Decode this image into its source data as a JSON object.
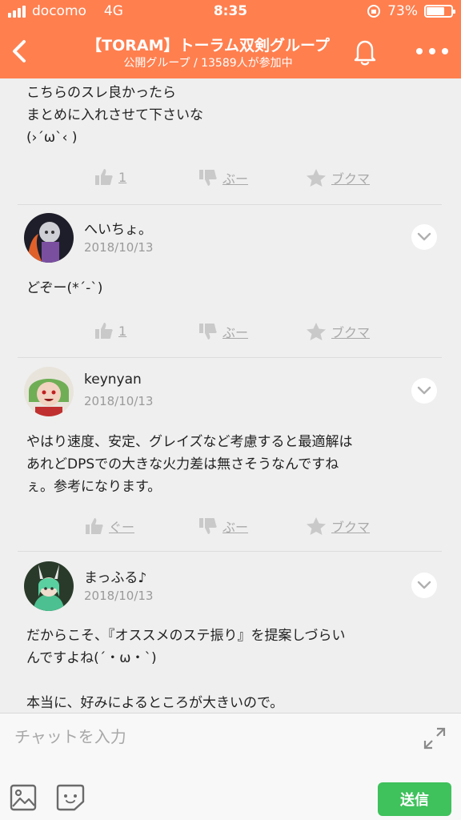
{
  "status_bar": {
    "carrier": "docomo",
    "network": "4G",
    "time": "8:35",
    "battery": "73%",
    "battery_level": 0.73
  },
  "header": {
    "title": "【TORAM】トーラム双剣グループ",
    "subtitle": "公開グループ / 13589人が参加中",
    "back_icon": "chevron-left-icon",
    "bell_icon": "bell-icon",
    "more_icon": "more-dots-icon"
  },
  "posts": [
    {
      "text": "こちらのスレ良かったら\nまとめに入れさせて下さいな\n(›´ω`‹ )",
      "reactions": {
        "like": "1",
        "dislike": "ぶー",
        "bookmark": "ブクマ"
      }
    },
    {
      "username": "へいちょ。",
      "date": "2018/10/13",
      "text": "どぞー(*´-`)",
      "reactions": {
        "like": "1",
        "dislike": "ぶー",
        "bookmark": "ブクマ"
      }
    },
    {
      "username": "keynyan",
      "date": "2018/10/13",
      "text": "やはり速度、安定、グレイズなど考慮すると最適解は\nあれどDPSでの大きな火力差は無さそうなんですね\nぇ。参考になります。",
      "reactions": {
        "like": "ぐー",
        "dislike": "ぶー",
        "bookmark": "ブクマ"
      }
    },
    {
      "username": "まっふる♪",
      "date": "2018/10/13",
      "text": "だからこそ、『オススメのステ振り』を提案しづらい\nんですよね(´・ω・`)\n\n本当に、好みによるところが大きいので。"
    }
  ],
  "composer": {
    "placeholder": "チャットを入力",
    "send_label": "送信",
    "image_icon": "image-icon",
    "sticker_icon": "sticker-icon",
    "expand_icon": "expand-icon"
  },
  "colors": {
    "accent": "#ff7f4f",
    "send": "#3fc15c",
    "reaction": "#a9a9a9"
  }
}
